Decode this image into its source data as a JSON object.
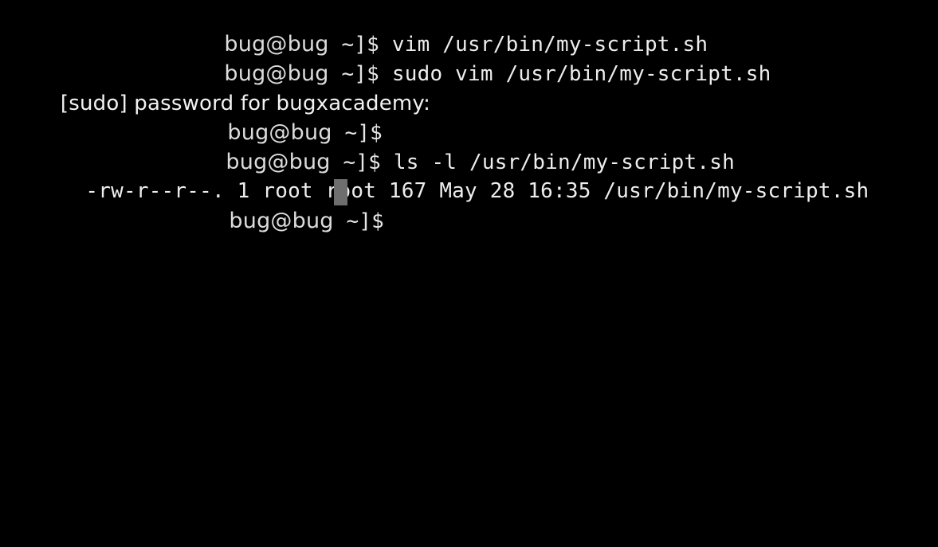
{
  "terminal": {
    "prompt_host": "bug@bug",
    "prompt_suffix": " ~]$ ",
    "lines": {
      "l1_cmd": "vim /usr/bin/my-script.sh",
      "l2_cmd": "sudo vim /usr/bin/my-script.sh",
      "l3_output": "[sudo] password for bugxacademy:",
      "l4_cmd": "",
      "l5_cmd": "ls -l /usr/bin/my-script.sh",
      "l6_output": "-rw-r--r--. 1 root root 167 May 28 16:35 /usr/bin/my-script.sh",
      "l7_cmd": ""
    },
    "colors": {
      "background": "#000000",
      "text": "#e6e6e6",
      "cursor": "#6e6e6e"
    }
  }
}
